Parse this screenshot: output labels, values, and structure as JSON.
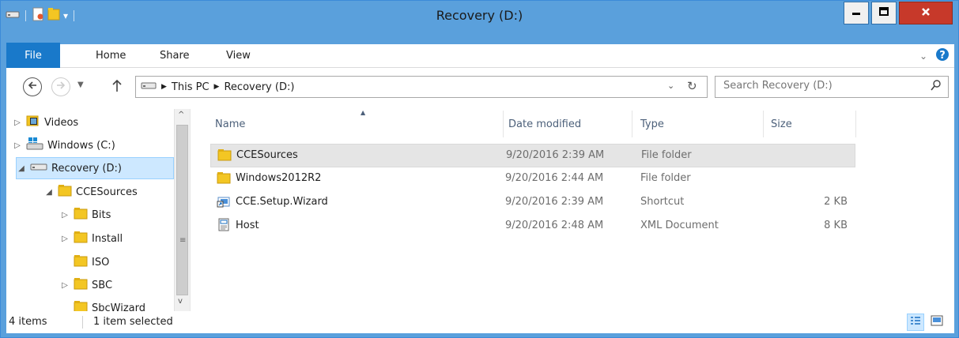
{
  "window": {
    "title": "Recovery (D:)"
  },
  "ribbon": {
    "tabs": [
      "File",
      "Home",
      "Share",
      "View"
    ]
  },
  "address": {
    "crumbs": [
      "This PC",
      "Recovery (D:)"
    ]
  },
  "search": {
    "placeholder": "Search Recovery (D:)"
  },
  "tree": [
    {
      "label": "Videos",
      "icon": "videos-folder-icon",
      "expander": "collapsed"
    },
    {
      "label": "Windows (C:)",
      "icon": "windows-drive-icon",
      "expander": "collapsed"
    },
    {
      "label": "Recovery (D:)",
      "icon": "drive-icon",
      "expander": "expanded",
      "selected": true
    },
    {
      "label": "CCESources",
      "icon": "folder-icon",
      "expander": "expanded"
    },
    {
      "label": "Bits",
      "icon": "folder-icon",
      "expander": "collapsed"
    },
    {
      "label": "Install",
      "icon": "folder-icon",
      "expander": "collapsed"
    },
    {
      "label": "ISO",
      "icon": "folder-icon",
      "expander": "none"
    },
    {
      "label": "SBC",
      "icon": "folder-icon",
      "expander": "collapsed"
    },
    {
      "label": "SbcWizard",
      "icon": "folder-icon",
      "expander": "none"
    }
  ],
  "columns": {
    "name": "Name",
    "date": "Date modified",
    "type": "Type",
    "size": "Size"
  },
  "files": [
    {
      "name": "CCESources",
      "date": "9/20/2016 2:39 AM",
      "type": "File folder",
      "size": "",
      "icon": "folder-icon",
      "selected": true
    },
    {
      "name": "Windows2012R2",
      "date": "9/20/2016 2:44 AM",
      "type": "File folder",
      "size": "",
      "icon": "folder-icon"
    },
    {
      "name": "CCE.Setup.Wizard",
      "date": "9/20/2016 2:39 AM",
      "type": "Shortcut",
      "size": "2 KB",
      "icon": "shortcut-icon"
    },
    {
      "name": "Host",
      "date": "9/20/2016 2:48 AM",
      "type": "XML Document",
      "size": "8 KB",
      "icon": "xml-document-icon"
    }
  ],
  "status": {
    "count": "4 items",
    "selected": "1 item selected"
  },
  "colors": {
    "titlebar": "#5aa0dc",
    "file_tab": "#1979ca",
    "close_button": "#c7392a",
    "tree_selection": "#cde8ff"
  }
}
